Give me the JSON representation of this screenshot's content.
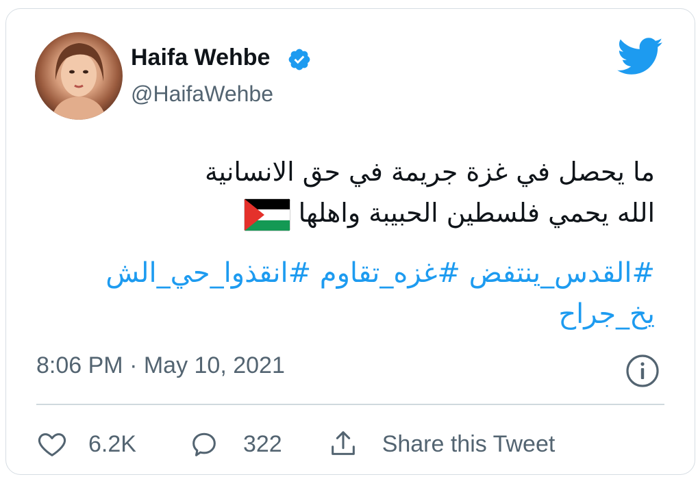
{
  "author": {
    "display_name": "Haifa Wehbe",
    "handle": "@HaifaWehbe",
    "verified": true,
    "avatar_icon": "profile-photo"
  },
  "tweet": {
    "text_lines": [
      "ما يحصل في غزة جريمة في حق الانسانية",
      "الله يحمي فلسطين الحبيبة واهلها"
    ],
    "emoji": "palestine-flag",
    "hashtag_lines": [
      "#القدس_ينتفض #غزه_تقاوم #انقذوا_حي_الش",
      "يخ_جراح"
    ],
    "timestamp": "8:06 PM · May 10, 2021"
  },
  "actions": {
    "likes": "6.2K",
    "replies": "322",
    "share_label": "Share this Tweet"
  },
  "colors": {
    "link": "#1d9bf0",
    "text": "#0f1419",
    "muted": "#536471",
    "border": "#d6dde3",
    "verified": "#1d9bf0",
    "flag_red": "#e4312b",
    "flag_black": "#000000",
    "flag_green": "#149954"
  }
}
